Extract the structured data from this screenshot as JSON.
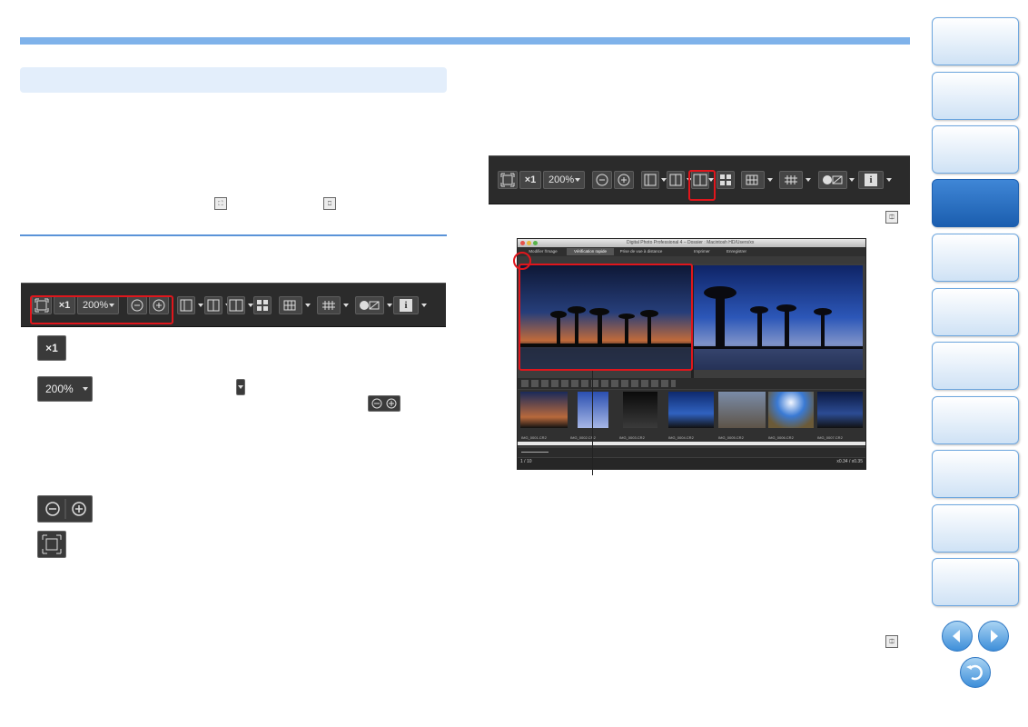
{
  "colors": {
    "accent": "#7fb2ea",
    "highlight": "#e0161c",
    "nav_active": "#1b5eaf",
    "toolbar": "#2b2b2b"
  },
  "toolbar": {
    "one_to_one": "×1",
    "zoom_value": "200%",
    "icons": [
      "fit-icon",
      "one-to-one-icon",
      "zoom-dropdown",
      "zoom-out-icon",
      "zoom-in-icon",
      "layout-horizontal-icon",
      "layout-vertical-icon",
      "compare-icon",
      "multi-view-icon",
      "grid-icon",
      "af-point-icon",
      "highlight-shadow-icon",
      "info-icon"
    ]
  },
  "explanations": {
    "x1_label": "×1",
    "zoom_label": "200%"
  },
  "screenshot": {
    "title": "Digital Photo Professional 4 – Dossier : Macintosh HD/Users/xx",
    "tabs": [
      "Modifier l'image",
      "Vérification rapide",
      "Prise de vue à distance"
    ],
    "toolbar_right": [
      "Imprimer",
      "Enregistrer"
    ],
    "thumbs": [
      "IMG_0001.CR2",
      "IMG_0002.CR2",
      "IMG_0003.CR2",
      "IMG_0004.CR2",
      "IMG_0005.CR2",
      "IMG_0006.CR2",
      "IMG_0007.CR2"
    ],
    "status_left": "1 / 10",
    "status_right": "x0.34 / x0.35"
  },
  "nav": {
    "tabs": 11,
    "active_index": 3
  }
}
